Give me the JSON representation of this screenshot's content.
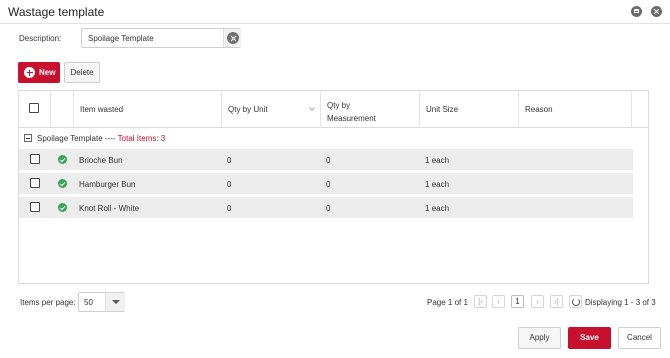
{
  "window": {
    "title": "Wastage template",
    "minimize_icon": "window-restore-icon",
    "close_icon": "close-circle-icon"
  },
  "description": {
    "label": "Description:",
    "value": "Spoilage Template"
  },
  "toolbar": {
    "new_label": "New",
    "delete_label": "Delete"
  },
  "grid": {
    "columns": [
      "Item wasted",
      "Qty by Unit",
      "Qty by Measurement",
      "Unit Size",
      "Reason"
    ],
    "group": {
      "name": "Spoilage Template ----",
      "total": "Total Items: 3"
    },
    "rows": [
      {
        "item": "Brioche Bun",
        "qty_unit": "0",
        "qty_measure": "0",
        "unit_size": "1 each",
        "reason": ""
      },
      {
        "item": "Hamburger Bun",
        "qty_unit": "0",
        "qty_measure": "0",
        "unit_size": "1 each",
        "reason": ""
      },
      {
        "item": "Knot Roll - White",
        "qty_unit": "0",
        "qty_measure": "0",
        "unit_size": "1 each",
        "reason": ""
      }
    ]
  },
  "pager": {
    "items_per_page_label": "Items per page:",
    "items_per_page": "50",
    "page_info": "Page 1 of 1",
    "current_page": "1",
    "displaying": "Displaying 1 - 3 of 3"
  },
  "footer": {
    "apply_label": "Apply",
    "save_label": "Save",
    "cancel_label": "Cancel"
  },
  "colors": {
    "accent": "#c8102e",
    "status_ok": "#3aa655"
  }
}
